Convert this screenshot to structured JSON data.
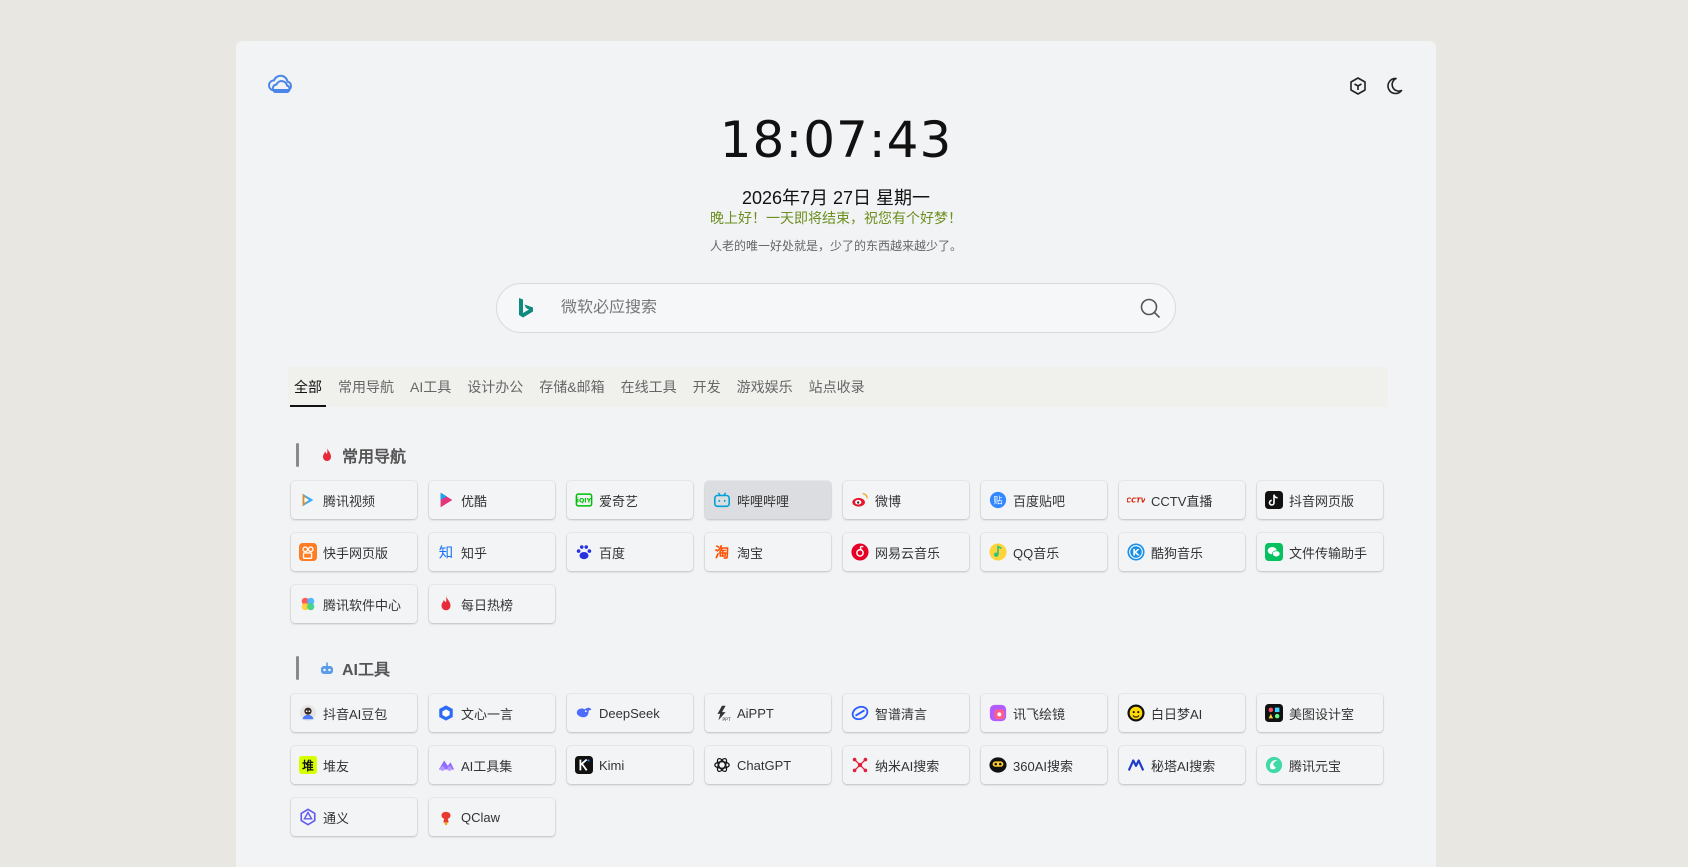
{
  "clock": "18:07:43",
  "date": "2026年7月 27日  星期一",
  "greeting": "晚上好！一天即将结束，祝您有个好梦！",
  "quote": "人老的唯一好处就是，少了的东西越来越少了。",
  "search": {
    "placeholder": "微软必应搜索",
    "engine_icon": "bing-icon"
  },
  "tabs": [
    "全部",
    "常用导航",
    "AI工具",
    "设计办公",
    "存储&邮箱",
    "在线工具",
    "开发",
    "游戏娱乐",
    "站点收录"
  ],
  "active_tab": "全部",
  "sections": [
    {
      "title": "常用导航",
      "icon": "fire-icon",
      "sites": [
        {
          "label": "腾讯视频",
          "icon": "tencent-video-icon"
        },
        {
          "label": "优酷",
          "icon": "youku-icon"
        },
        {
          "label": "爱奇艺",
          "icon": "iqiyi-icon"
        },
        {
          "label": "哔哩哔哩",
          "icon": "bilibili-icon"
        },
        {
          "label": "微博",
          "icon": "weibo-icon"
        },
        {
          "label": "百度贴吧",
          "icon": "tieba-icon"
        },
        {
          "label": "CCTV直播",
          "icon": "cctv-icon"
        },
        {
          "label": "抖音网页版",
          "icon": "douyin-icon"
        },
        {
          "label": "快手网页版",
          "icon": "kuaishou-icon"
        },
        {
          "label": "知乎",
          "icon": "zhihu-icon"
        },
        {
          "label": "百度",
          "icon": "baidu-icon"
        },
        {
          "label": "淘宝",
          "icon": "taobao-icon"
        },
        {
          "label": "网易云音乐",
          "icon": "netease-music-icon"
        },
        {
          "label": "QQ音乐",
          "icon": "qq-music-icon"
        },
        {
          "label": "酷狗音乐",
          "icon": "kugou-icon"
        },
        {
          "label": "文件传输助手",
          "icon": "wechat-icon"
        },
        {
          "label": "腾讯软件中心",
          "icon": "tencent-software-icon"
        },
        {
          "label": "每日热榜",
          "icon": "hot-list-icon"
        }
      ]
    },
    {
      "title": "AI工具",
      "icon": "robot-icon",
      "sites": [
        {
          "label": "抖音AI豆包",
          "icon": "doubao-icon"
        },
        {
          "label": "文心一言",
          "icon": "wenxin-icon"
        },
        {
          "label": "DeepSeek",
          "icon": "deepseek-icon"
        },
        {
          "label": "AiPPT",
          "icon": "aippt-icon"
        },
        {
          "label": "智谱清言",
          "icon": "zhipu-icon"
        },
        {
          "label": "讯飞绘镜",
          "icon": "xunfei-icon"
        },
        {
          "label": "白日梦AI",
          "icon": "bairimeng-icon"
        },
        {
          "label": "美图设计室",
          "icon": "meitu-icon"
        },
        {
          "label": "堆友",
          "icon": "duiyou-icon"
        },
        {
          "label": "AI工具集",
          "icon": "ai-tools-icon"
        },
        {
          "label": "Kimi",
          "icon": "kimi-icon"
        },
        {
          "label": "ChatGPT",
          "icon": "chatgpt-icon"
        },
        {
          "label": "纳米AI搜索",
          "icon": "nami-icon"
        },
        {
          "label": "360AI搜索",
          "icon": "360ai-icon"
        },
        {
          "label": "秘塔AI搜索",
          "icon": "metaso-icon"
        },
        {
          "label": "腾讯元宝",
          "icon": "yuanbao-icon"
        },
        {
          "label": "通义",
          "icon": "tongyi-icon"
        },
        {
          "label": "QClaw",
          "icon": "qclaw-icon"
        }
      ]
    }
  ],
  "colors": {
    "accent_green": "#6c8f1f",
    "panel_bg": "#f2f3f5",
    "page_bg": "#e9e7e2"
  }
}
